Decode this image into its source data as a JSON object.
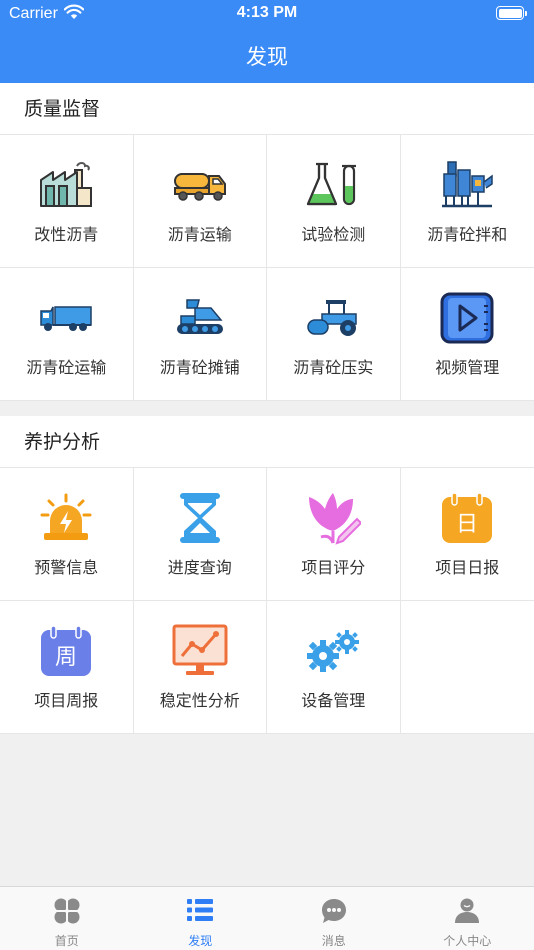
{
  "status_bar": {
    "carrier": "Carrier",
    "time": "4:13 PM"
  },
  "nav": {
    "title": "发现"
  },
  "quality": {
    "title": "质量监督",
    "items": [
      {
        "label": "改性沥青",
        "icon": "factory-icon"
      },
      {
        "label": "沥青运输",
        "icon": "tanker-truck-icon"
      },
      {
        "label": "试验检测",
        "icon": "lab-flask-icon"
      },
      {
        "label": "沥青砼拌和",
        "icon": "mixing-plant-icon"
      },
      {
        "label": "沥青砼运输",
        "icon": "dump-truck-icon"
      },
      {
        "label": "沥青砼摊铺",
        "icon": "paver-icon"
      },
      {
        "label": "沥青砼压实",
        "icon": "road-roller-icon"
      },
      {
        "label": "视频管理",
        "icon": "video-play-icon"
      }
    ]
  },
  "maintenance": {
    "title": "养护分析",
    "items": [
      {
        "label": "预警信息",
        "icon": "alarm-light-icon"
      },
      {
        "label": "进度查询",
        "icon": "hourglass-icon"
      },
      {
        "label": "项目评分",
        "icon": "flower-pen-icon"
      },
      {
        "label": "项目日报",
        "icon": "daily-calendar-icon",
        "glyph": "日"
      },
      {
        "label": "项目周报",
        "icon": "weekly-calendar-icon",
        "glyph": "周"
      },
      {
        "label": "稳定性分析",
        "icon": "monitor-chart-icon"
      },
      {
        "label": "设备管理",
        "icon": "gears-icon"
      }
    ]
  },
  "tabbar": {
    "tabs": [
      {
        "label": "首页",
        "icon": "home-grid-icon",
        "active": false
      },
      {
        "label": "发现",
        "icon": "list-icon",
        "active": true
      },
      {
        "label": "消息",
        "icon": "chat-bubble-icon",
        "active": false
      },
      {
        "label": "个人中心",
        "icon": "person-icon",
        "active": false
      }
    ]
  },
  "colors": {
    "primary": "#3b8bf7",
    "tab_active": "#2f7ef5",
    "tab_inactive": "#888888"
  }
}
